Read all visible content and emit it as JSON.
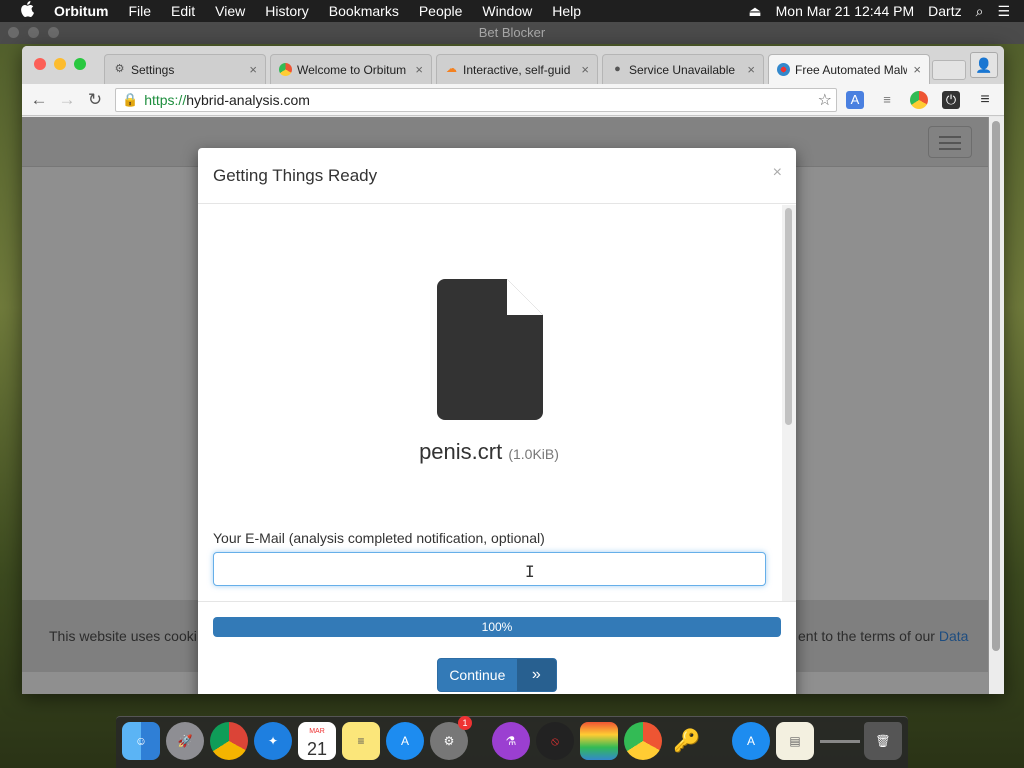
{
  "menubar": {
    "apple": "",
    "items": [
      "Orbitum",
      "File",
      "Edit",
      "View",
      "History",
      "Bookmarks",
      "People",
      "Window",
      "Help"
    ],
    "clock": "Mon Mar 21  12:44 PM",
    "user": "Dartz"
  },
  "window_title": "Bet Blocker",
  "tabs": [
    {
      "label": "Settings",
      "icon": "gear-icon",
      "close": "×"
    },
    {
      "label": "Welcome to Orbitum",
      "icon": "orbitum-icon",
      "close": "×"
    },
    {
      "label": "Interactive, self-guid",
      "icon": "cloud-icon",
      "close": "×"
    },
    {
      "label": "Service Unavailable",
      "icon": "apple-icon",
      "close": "×"
    },
    {
      "label": "Free Automated Malw",
      "icon": "hybrid-analysis-icon",
      "close": "×"
    }
  ],
  "address": {
    "scheme": "https://",
    "host": "hybrid-analysis.com"
  },
  "modal": {
    "title": "Getting Things Ready",
    "close": "×",
    "filename": "penis.crt",
    "filesize": "(1.0KiB)",
    "email_label": "Your E-Mail (analysis completed notification, optional)",
    "email_value": "",
    "progress_label": "100%",
    "progress_value": 100,
    "continue_label": "Continue",
    "continue_icon": "»"
  },
  "cookie": {
    "left_text": "This website uses cooki",
    "right_text": "ent to the terms of our ",
    "link_text": "Data"
  },
  "dock": {
    "calendar_month": "MAR",
    "calendar_day": "21",
    "settings_badge": "1"
  }
}
